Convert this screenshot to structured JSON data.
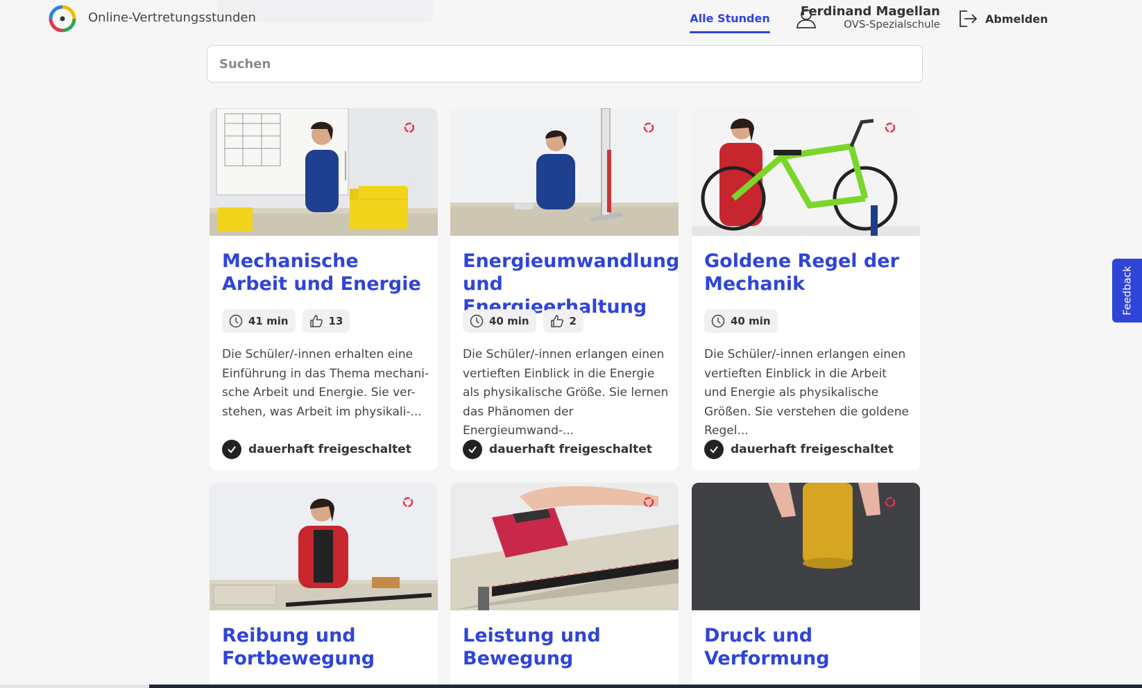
{
  "header": {
    "app_title": "Online-Vertretungsstunden",
    "nav_tab": "Alle Stunden",
    "user_name": "Ferdinand Magellan",
    "user_school": "OVS-Spezialschule",
    "logout_label": "Abmelden"
  },
  "search": {
    "placeholder": "Suchen"
  },
  "cards": [
    {
      "title": "Mechanische Arbeit und Energie",
      "duration": "41 min",
      "likes": "13",
      "description": "Die Schüler/-innen erhalten eine Einführung in das Thema mechani-sche Arbeit und Energie. Sie ver-stehen, was Arbeit im physikali-...",
      "status": "dauerhaft freigeschaltet"
    },
    {
      "title": "Energieumwandlung und Energieerhaltung",
      "duration": "40 min",
      "likes": "2",
      "description": "Die Schüler/-innen erlangen einen vertieften Einblick in die Energie als physikalische Größe. Sie lernen das Phänomen der Energieumwand-...",
      "status": "dauerhaft freigeschaltet"
    },
    {
      "title": "Goldene Regel der Mechanik",
      "duration": "40 min",
      "description": "Die Schüler/-innen erlangen einen vertieften Einblick in die Arbeit und Energie als physikalische Größen. Sie verstehen die goldene Regel...",
      "status": "dauerhaft freigeschaltet"
    },
    {
      "title": "Reibung und Fortbewegung"
    },
    {
      "title": "Leistung und Bewegung"
    },
    {
      "title": "Druck und Verformung"
    }
  ],
  "feedback_label": "Feedback",
  "colors": {
    "accent": "#2f45d8",
    "logo_red": "#e8344e",
    "logo_yellow": "#f5b800",
    "logo_green": "#2fa84f",
    "logo_blue": "#2f7fe0"
  }
}
